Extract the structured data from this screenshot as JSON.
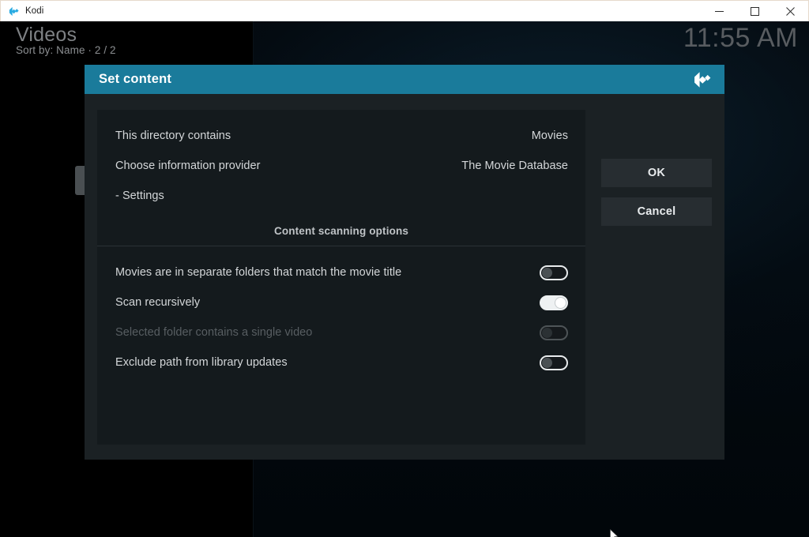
{
  "window": {
    "app_title": "Kodi",
    "app_icon": "kodi-logo-icon",
    "minimize_label": "Minimize",
    "maximize_label": "Maximize",
    "close_label": "Close"
  },
  "kodi_header": {
    "title": "Videos",
    "subtitle": "Sort by: Name  ·  2 / 2",
    "clock": "11:55 AM"
  },
  "dialog": {
    "title": "Set content",
    "logo_icon": "kodi-logo-icon",
    "accent_color": "#1a7b9b",
    "rows": [
      {
        "label": "This directory contains",
        "value": "Movies"
      },
      {
        "label": "Choose information provider",
        "value": "The Movie Database"
      },
      {
        "label": "- Settings",
        "value": ""
      }
    ],
    "section_title": "Content scanning options",
    "toggles": [
      {
        "label": "Movies are in separate folders that match the movie title",
        "state": "off",
        "disabled": false
      },
      {
        "label": "Scan recursively",
        "state": "on",
        "disabled": false
      },
      {
        "label": "Selected folder contains a single video",
        "state": "off",
        "disabled": true
      },
      {
        "label": "Exclude path from library updates",
        "state": "off",
        "disabled": false
      }
    ],
    "buttons": [
      {
        "label": "OK"
      },
      {
        "label": "Cancel"
      }
    ]
  }
}
